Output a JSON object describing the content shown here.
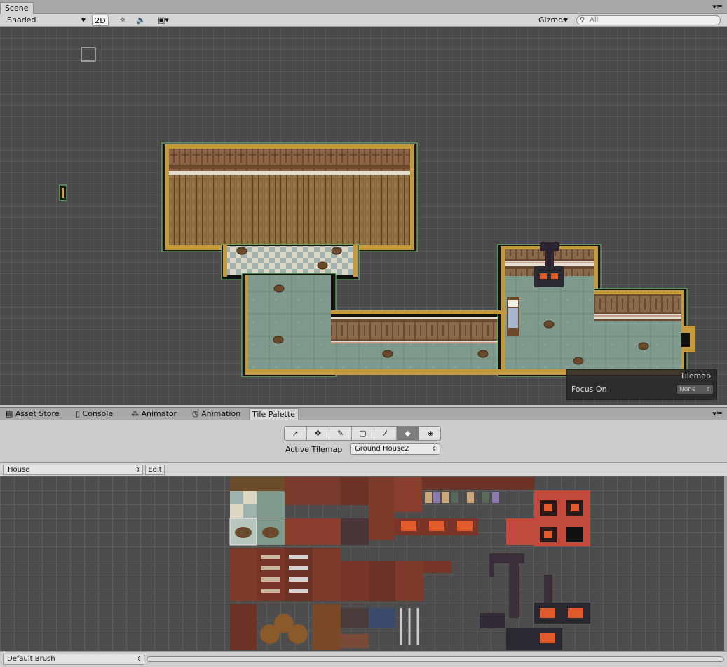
{
  "scene": {
    "tab_label": "Scene",
    "shading_mode": "Shaded",
    "mode_2d_label": "2D",
    "gizmos_label": "Gizmos",
    "search_placeholder": "All"
  },
  "tilemap_overlay": {
    "title": "Tilemap",
    "focus_label": "Focus On",
    "focus_value": "None"
  },
  "dock_tabs": [
    {
      "label": "Asset Store",
      "icon": "asset-store-icon"
    },
    {
      "label": "Console",
      "icon": "console-icon"
    },
    {
      "label": "Animator",
      "icon": "animator-icon"
    },
    {
      "label": "Animation",
      "icon": "animation-icon"
    },
    {
      "label": "Tile Palette",
      "icon": "",
      "active": true
    }
  ],
  "palette_tools": [
    "select-icon",
    "move-icon",
    "brush-icon",
    "box-fill-icon",
    "picker-icon",
    "eraser-icon",
    "fill-icon"
  ],
  "palette_active_tool_index": 5,
  "active_tilemap_label": "Active Tilemap",
  "active_tilemap_value": "Ground House2",
  "palette_name": "House",
  "edit_label": "Edit",
  "brush_value": "Default Brush",
  "colors": {
    "scene_bg": "#4a4a4a",
    "wall_wood": "#6b4a2c",
    "floor_teal": "#7f9c8c",
    "floor_wood": "#8a6a3f",
    "trim_gold": "#c59a3b",
    "brick_red": "#b8473b"
  }
}
